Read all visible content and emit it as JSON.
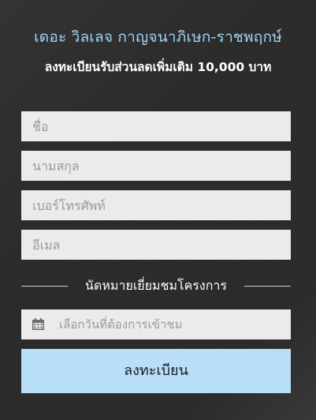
{
  "header": {
    "title": "เดอะ วิลเลจ กาญจนาภิเษก-ราชพฤกษ์",
    "subtitle": "ลงทะเบียนรับส่วนลดเพิ่มเติม 10,000 บาท"
  },
  "form": {
    "name_placeholder": "ชื่อ",
    "surname_placeholder": "นามสกุล",
    "phone_placeholder": "เบอร์โทรศัพท์",
    "email_placeholder": "อีเมล",
    "appointment_heading": "นัดหมายเยี่ยมชมโครงการ",
    "date_placeholder": "เลือกวันที่ต้องการเข้าชม",
    "date_icon": "calendar-icon",
    "submit_label": "ลงทะเบียน"
  },
  "colors": {
    "background": "#2b2b2b",
    "title": "#9fd3f2",
    "input_background": "#ebebeb",
    "button": "#b9dff8"
  }
}
